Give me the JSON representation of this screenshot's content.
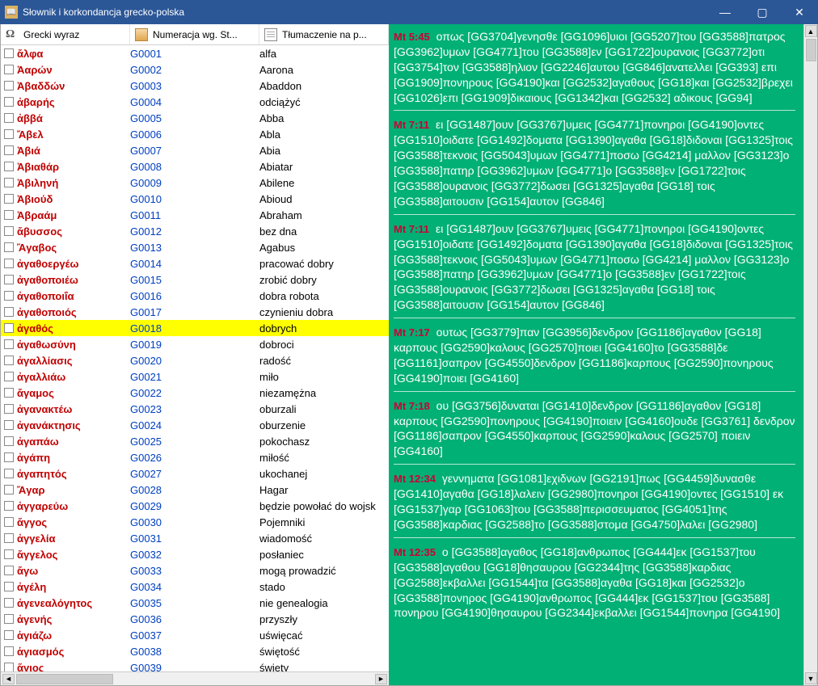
{
  "window": {
    "title": "Słownik i korkondancja grecko-polska"
  },
  "headers": {
    "col1": "Grecki wyraz",
    "col2": "Numeracja wg. St...",
    "col3": "Tłumaczenie na p..."
  },
  "selected_index": 17,
  "rows": [
    {
      "g": "ἄλφα",
      "n": "G0001",
      "t": "alfa"
    },
    {
      "g": "Ἀαρών",
      "n": "G0002",
      "t": "Aarona"
    },
    {
      "g": "Ἀβαδδών",
      "n": "G0003",
      "t": "Abaddon"
    },
    {
      "g": "ἀβαρής",
      "n": "G0004",
      "t": "odciążyć"
    },
    {
      "g": "ἀββά",
      "n": "G0005",
      "t": "Abba"
    },
    {
      "g": "Ἄβελ",
      "n": "G0006",
      "t": "Abla"
    },
    {
      "g": "Ἀβιά",
      "n": "G0007",
      "t": "Abia"
    },
    {
      "g": "Ἀβιαθάρ",
      "n": "G0008",
      "t": "Abiatar"
    },
    {
      "g": "Ἀβιληνή",
      "n": "G0009",
      "t": "Abilene"
    },
    {
      "g": "Ἀβιούδ",
      "n": "G0010",
      "t": "Abioud"
    },
    {
      "g": "Ἀβραάμ",
      "n": "G0011",
      "t": "Abraham"
    },
    {
      "g": "ἄβυσσος",
      "n": "G0012",
      "t": "bez dna"
    },
    {
      "g": "Ἅγαβος",
      "n": "G0013",
      "t": "Agabus"
    },
    {
      "g": "ἀγαθοεργέω",
      "n": "G0014",
      "t": "pracować dobry"
    },
    {
      "g": "ἀγαθοποιέω",
      "n": "G0015",
      "t": "zrobić dobry"
    },
    {
      "g": "ἀγαθοποιΐα",
      "n": "G0016",
      "t": "dobra robota"
    },
    {
      "g": "ἀγαθοποιός",
      "n": "G0017",
      "t": "czynieniu dobra"
    },
    {
      "g": "ἀγαθός",
      "n": "G0018",
      "t": "dobrych"
    },
    {
      "g": "ἀγαθωσύνη",
      "n": "G0019",
      "t": "dobroci"
    },
    {
      "g": "ἀγαλλίασις",
      "n": "G0020",
      "t": "radość"
    },
    {
      "g": "ἀγαλλιάω",
      "n": "G0021",
      "t": "miło"
    },
    {
      "g": "ἄγαμος",
      "n": "G0022",
      "t": "niezamężna"
    },
    {
      "g": "ἀγανακτέω",
      "n": "G0023",
      "t": "oburzali"
    },
    {
      "g": "ἀγανάκτησις",
      "n": "G0024",
      "t": "oburzenie"
    },
    {
      "g": "ἀγαπάω",
      "n": "G0025",
      "t": "pokochasz"
    },
    {
      "g": "ἀγάπη",
      "n": "G0026",
      "t": "miłość"
    },
    {
      "g": "ἀγαπητός",
      "n": "G0027",
      "t": "ukochanej"
    },
    {
      "g": "Ἄγαρ",
      "n": "G0028",
      "t": "Hagar"
    },
    {
      "g": "ἀγγαρεύω",
      "n": "G0029",
      "t": "będzie powołać do wojsk"
    },
    {
      "g": "ἄγγος",
      "n": "G0030",
      "t": "Pojemniki"
    },
    {
      "g": "ἀγγελία",
      "n": "G0031",
      "t": "wiadomość"
    },
    {
      "g": "ἄγγελος",
      "n": "G0032",
      "t": "posłaniec"
    },
    {
      "g": "ἄγω",
      "n": "G0033",
      "t": "mogą prowadzić"
    },
    {
      "g": "ἀγέλη",
      "n": "G0034",
      "t": "stado"
    },
    {
      "g": "ἀγενεαλόγητος",
      "n": "G0035",
      "t": "nie genealogia"
    },
    {
      "g": "ἀγενής",
      "n": "G0036",
      "t": "przyszły"
    },
    {
      "g": "ἁγιάζω",
      "n": "G0037",
      "t": "uświęcać"
    },
    {
      "g": "ἁγιασμός",
      "n": "G0038",
      "t": "świętość"
    },
    {
      "g": "ἅγιος",
      "n": "G0039",
      "t": "święty"
    }
  ],
  "concordance": [
    {
      "ref": "Mt 5:45",
      "text": "οπως [GG3704]γενησθε [GG1096]υιοι [GG5207]του [GG3588]πατρος [GG3962]υμων [GG4771]του [GG3588]εν [GG1722]ουρανοις [GG3772]οτι [GG3754]τον [GG3588]ηλιον [GG2246]αυτου [GG846]ανατελλει [GG393] επι [GG1909]πονηρους [GG4190]και [GG2532]αγαθους [GG18]και [GG2532]βρεχει [GG1026]επι [GG1909]δικαιους [GG1342]και [GG2532] αδικους [GG94]"
    },
    {
      "ref": "Mt 7:11",
      "text": "ει [GG1487]ουν [GG3767]υμεις [GG4771]πονηροι [GG4190]οντες [GG1510]οιδατε [GG1492]δοματα [GG1390]αγαθα [GG18]διδοναι [GG1325]τοις [GG3588]τεκνοις [GG5043]υμων [GG4771]ποσω [GG4214] μαλλον [GG3123]ο [GG3588]πατηρ [GG3962]υμων [GG4771]ο [GG3588]εν [GG1722]τοις [GG3588]ουρανοις [GG3772]δωσει [GG1325]αγαθα [GG18] τοις [GG3588]αιτουσιν [GG154]αυτον [GG846]"
    },
    {
      "ref": "Mt 7:11",
      "text": "ει [GG1487]ουν [GG3767]υμεις [GG4771]πονηροι [GG4190]οντες [GG1510]οιδατε [GG1492]δοματα [GG1390]αγαθα [GG18]διδοναι [GG1325]τοις [GG3588]τεκνοις [GG5043]υμων [GG4771]ποσω [GG4214] μαλλον [GG3123]ο [GG3588]πατηρ [GG3962]υμων [GG4771]ο [GG3588]εν [GG1722]τοις [GG3588]ουρανοις [GG3772]δωσει [GG1325]αγαθα [GG18] τοις [GG3588]αιτουσιν [GG154]αυτον [GG846]"
    },
    {
      "ref": "Mt 7:17",
      "text": "ουτως [GG3779]παν [GG3956]δενδρον [GG1186]αγαθον [GG18] καρπους [GG2590]καλους [GG2570]ποιει [GG4160]το [GG3588]δε [GG1161]σαπρον [GG4550]δενδρον [GG1186]καρπους [GG2590]πονηρους [GG4190]ποιει [GG4160]"
    },
    {
      "ref": "Mt 7:18",
      "text": "ου [GG3756]δυναται [GG1410]δενδρον [GG1186]αγαθον [GG18] καρπους [GG2590]πονηρους [GG4190]ποιειν [GG4160]ουδε [GG3761] δενδρον [GG1186]σαπρον [GG4550]καρπους [GG2590]καλους [GG2570] ποιειν [GG4160]"
    },
    {
      "ref": "Mt 12:34",
      "text": "γεννηματα [GG1081]εχιδνων [GG2191]πως [GG4459]δυνασθε [GG1410]αγαθα [GG18]λαλειν [GG2980]πονηροι [GG4190]οντες [GG1510] εκ [GG1537]γαρ [GG1063]του [GG3588]περισσευματος [GG4051]της [GG3588]καρδιας [GG2588]το [GG3588]στομα [GG4750]λαλει [GG2980]"
    },
    {
      "ref": "Mt 12:35",
      "text": "ο [GG3588]αγαθος [GG18]ανθρωπος [GG444]εκ [GG1537]του [GG3588]αγαθου [GG18]θησαυρου [GG2344]της [GG3588]καρδιας [GG2588]εκβαλλει [GG1544]τα [GG3588]αγαθα [GG18]και [GG2532]ο [GG3588]πονηρος [GG4190]ανθρωπος [GG444]εκ [GG1537]του [GG3588] πονηρου [GG4190]θησαυρου [GG2344]εκβαλλει [GG1544]πονηρα [GG4190]"
    }
  ]
}
